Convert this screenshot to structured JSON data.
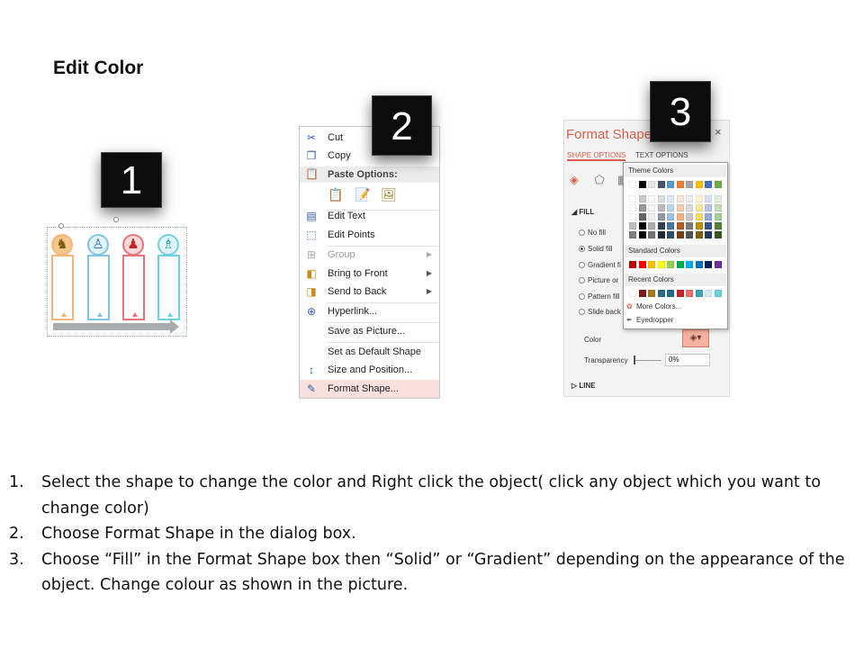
{
  "title": "Edit Color",
  "badges": {
    "one": "1",
    "two": "2",
    "three": "3"
  },
  "context_menu": {
    "cut": "Cut",
    "copy": "Copy",
    "paste_options": "Paste Options:",
    "edit_text": "Edit Text",
    "edit_points": "Edit Points",
    "group": "Group",
    "bring_to_front": "Bring to Front",
    "send_to_back": "Send to Back",
    "hyperlink": "Hyperlink...",
    "save_as_picture": "Save as Picture...",
    "set_default_shape": "Set as Default Shape",
    "size_and_position": "Size and Position...",
    "format_shape": "Format Shape..."
  },
  "format_panel": {
    "title": "Format Shape",
    "close": "×",
    "tab_shape": "SHAPE OPTIONS",
    "tab_text": "TEXT OPTIONS",
    "fill_section": "FILL",
    "no_fill": "No fill",
    "solid_fill": "Solid fill",
    "gradient_fill": "Gradient fi",
    "picture_fill": "Picture or",
    "pattern_fill": "Pattern fill",
    "slide_bg": "Slide back",
    "color_label": "Color",
    "transparency_label": "Transparency",
    "transparency_value": "0%",
    "line_section": "LINE"
  },
  "color_picker": {
    "theme_colors": "Theme Colors",
    "standard_colors": "Standard Colors",
    "recent_colors": "Recent Colors",
    "more_colors": "More Colors...",
    "eyedropper": "Eyedropper",
    "theme_row": [
      "#ffffff",
      "#000000",
      "#e7e6e6",
      "#44546a",
      "#5b9bd5",
      "#ed7d31",
      "#a5a5a5",
      "#ffc000",
      "#4472c4",
      "#70ad47"
    ],
    "standard_row": [
      "#c00000",
      "#ff0000",
      "#ffc000",
      "#ffff00",
      "#92d050",
      "#00b050",
      "#00b0f0",
      "#0070c0",
      "#002060",
      "#7030a0"
    ],
    "recent_row": [
      "#ffffff",
      "#7f1a1a",
      "#a87b1c",
      "#2a6b8a",
      "#1f6f8b",
      "#c1272d",
      "#ef6f6c",
      "#3aa3b5",
      "#d6ecf3",
      "#6ad0e0"
    ]
  },
  "instructions": [
    {
      "num": "1.",
      "text": "Select the shape to change the color and Right click the object( click any object which you want to change color)"
    },
    {
      "num": "2.",
      "text": "Choose Format Shape in the dialog box."
    },
    {
      "num": "3.",
      "text": "Choose “Fill” in the Format Shape box then “Solid” or “Gradient” depending on the appearance of the object. Change colour as shown in the picture."
    }
  ],
  "colors": {
    "accent_orange": "#f6b47a",
    "accent_blue": "#7fc3e8",
    "accent_red": "#e8747a",
    "accent_teal": "#6fd0e0",
    "format_title": "#d8604a"
  }
}
